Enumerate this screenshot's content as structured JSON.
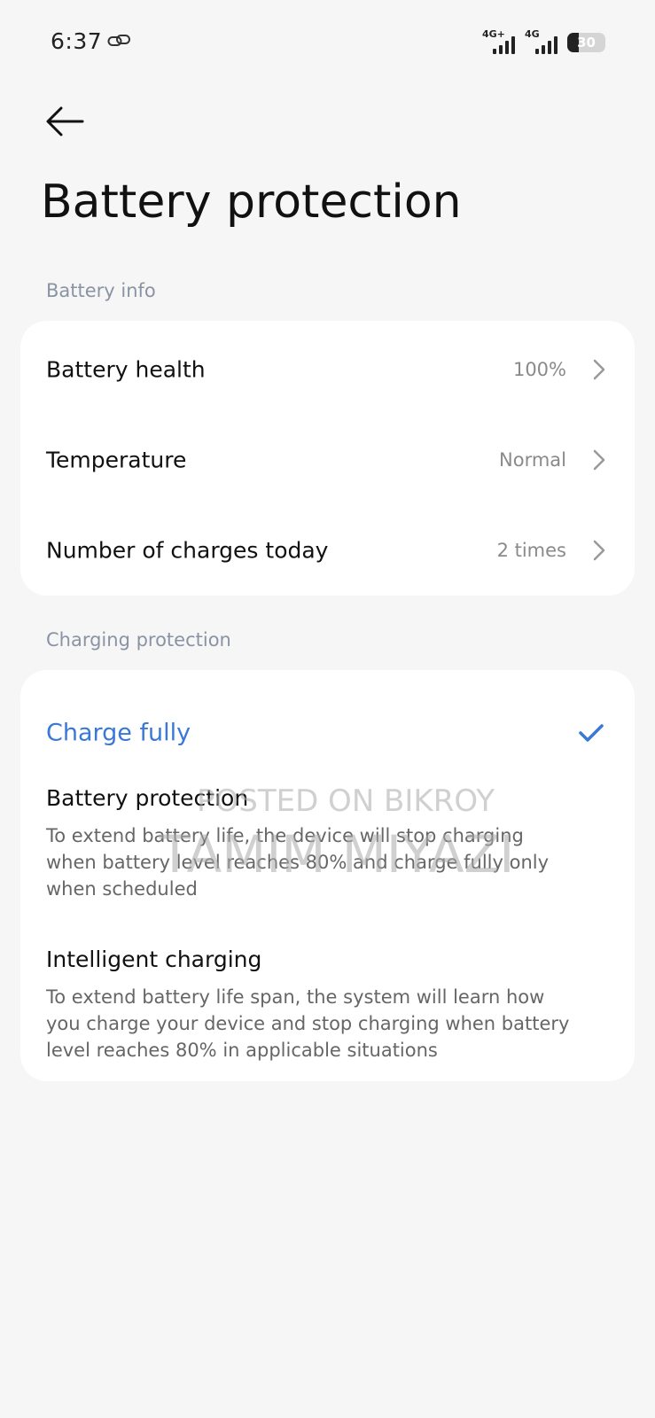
{
  "status_bar": {
    "time": "6:37",
    "network1_label": "4G+",
    "network2_label": "4G",
    "battery_level": "30"
  },
  "header": {
    "title": "Battery protection"
  },
  "battery_info": {
    "section_label": "Battery info",
    "rows": [
      {
        "label": "Battery health",
        "value": "100%"
      },
      {
        "label": "Temperature",
        "value": "Normal"
      },
      {
        "label": "Number of charges today",
        "value": "2 times"
      }
    ]
  },
  "charging_protection": {
    "section_label": "Charging protection",
    "options": [
      {
        "label": "Charge fully",
        "selected": true
      },
      {
        "label": "Battery protection",
        "description": "To extend battery life, the device will stop charging when battery level reaches 80% and charge fully only when scheduled"
      },
      {
        "label": "Intelligent charging",
        "description": "To extend battery life span, the system will learn how you charge your device and stop charging when battery level reaches 80% in applicable situations"
      }
    ]
  },
  "watermark": {
    "line1": "POSTED ON BIKROY",
    "line2": "TAMIM MIYAZI"
  },
  "colors": {
    "accent": "#3a78d8",
    "background": "#f6f6f6",
    "card": "#ffffff",
    "section_label": "#8a93a4"
  }
}
